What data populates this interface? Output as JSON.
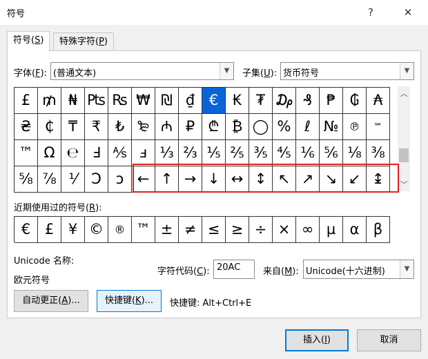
{
  "window": {
    "title": "符号",
    "help": "?",
    "close": "✕"
  },
  "tabs": [
    {
      "label": "符号(",
      "key": "S",
      "suffix": ")"
    },
    {
      "label": "特殊字符(",
      "key": "P",
      "suffix": ")"
    }
  ],
  "font": {
    "label": "字体(",
    "key": "F",
    "suffix": "):",
    "value": "(普通文本)"
  },
  "subset": {
    "label": "子集(",
    "key": "U",
    "suffix": "):",
    "value": "货币符号"
  },
  "symbol_rows": [
    [
      "£",
      "₥",
      "₦",
      "₧",
      "₨",
      "₩",
      "₪",
      "₫",
      "€",
      "₭",
      "₮",
      "₯",
      "₰",
      "₱",
      "₲",
      "₳"
    ],
    [
      "₴",
      "₵",
      "₸",
      "₹",
      "₺",
      "₻",
      "₼",
      "₽",
      "₾",
      "₿",
      "◯",
      "%",
      "ℓ",
      "№",
      "℗",
      "℠"
    ],
    [
      "™",
      "Ω",
      "℮",
      "Ⅎ",
      "⅍",
      "ⅎ",
      "⅓",
      "⅔",
      "⅕",
      "⅖",
      "⅗",
      "⅘",
      "⅙",
      "⅚",
      "⅛",
      "⅜"
    ],
    [
      "⅝",
      "⅞",
      "⅟",
      "Ↄ",
      "ↄ",
      "←",
      "↑",
      "→",
      "↓",
      "↔",
      "↕",
      "↖",
      "↗",
      "↘",
      "↙",
      "↨"
    ]
  ],
  "selected_symbol": "€",
  "recent": {
    "label": "近期使用过的符号(",
    "key": "R",
    "suffix": "):",
    "symbols": [
      "€",
      "£",
      "¥",
      "©",
      "®",
      "™",
      "±",
      "≠",
      "≤",
      "≥",
      "÷",
      "×",
      "∞",
      "µ",
      "α",
      "β"
    ]
  },
  "unicode_name_label": "Unicode 名称:",
  "unicode_name_value": "欧元符号",
  "char_code": {
    "label": "字符代码(",
    "key": "C",
    "suffix": "):",
    "value": "20AC"
  },
  "from": {
    "label": "来自(",
    "key": "M",
    "suffix": "):",
    "value": "Unicode(十六进制)"
  },
  "buttons": {
    "autocorrect": {
      "label": "自动更正(",
      "key": "A",
      "suffix": ")..."
    },
    "shortcut": {
      "label": "快捷键(",
      "key": "K",
      "suffix": ")..."
    },
    "insert": {
      "label": "插入(",
      "key": "I",
      "suffix": ")"
    },
    "cancel": "取消"
  },
  "shortcut_info": "快捷键: Alt+Ctrl+E",
  "colors": {
    "selection": "#0a64d6",
    "highlight_border": "#e02020",
    "default_button": "#0078d7"
  }
}
